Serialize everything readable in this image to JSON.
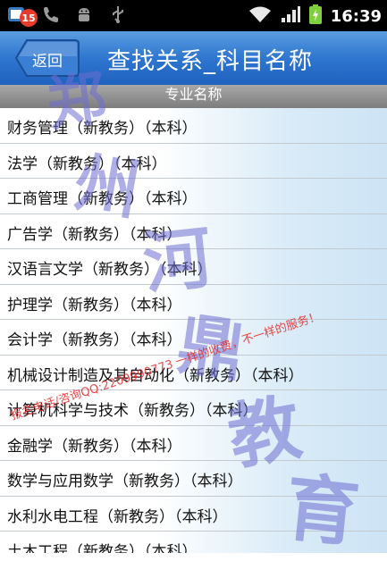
{
  "status_bar": {
    "notification_count": "15",
    "time": "16:39"
  },
  "header": {
    "back_label": "返回",
    "title": "查找关系_科目名称"
  },
  "section_header": "专业名称",
  "list": {
    "items": [
      "财务管理（新教务）（本科）",
      "法学（新教务）（本科）",
      "工商管理（新教务）（本科）",
      "广告学（新教务）（本科）",
      "汉语言文学（新教务）（本科）",
      "护理学（新教务）（本科）",
      "会计学（新教务）（本科）",
      "机械设计制造及其自动化（新教务）（本科）",
      "计算机科学与技术（新教务）（本科）",
      "金融学（新教务）（本科）",
      "数学与应用数学（新教务）（本科）",
      "水利水电工程（新教务）（本科）",
      "土木工程（新教务）（本科）"
    ]
  },
  "watermark": {
    "chars": [
      "郑",
      "州",
      "河",
      "鼎",
      "教",
      "育"
    ],
    "line": "报名电话/咨询QQ:2209990773 一样的收费，不一样的服务！"
  },
  "colors": {
    "title_bar": "#2e76cf",
    "section_bar": "#8c8c8c",
    "row_tint": "#d9ebf7",
    "watermark_blue": "#6e6ed2",
    "watermark_red": "#e82828"
  }
}
